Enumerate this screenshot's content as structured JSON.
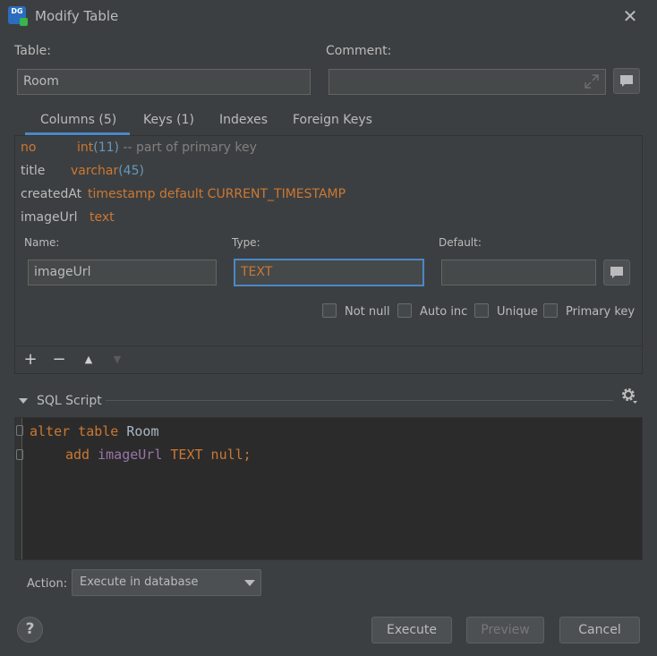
{
  "window": {
    "title": "Modify Table",
    "app_icon": "DG",
    "close_icon": "✕"
  },
  "table": {
    "label": "Table:",
    "value": "Room"
  },
  "comment": {
    "label": "Comment:",
    "value": ""
  },
  "tabs": [
    {
      "label": "Columns (5)",
      "active": true
    },
    {
      "label": "Keys (1)"
    },
    {
      "label": "Indexes"
    },
    {
      "label": "Foreign Keys"
    }
  ],
  "columns": [
    {
      "name": "no",
      "type": "int",
      "size": "(11)",
      "extra": "-- part of primary key"
    },
    {
      "name": "title",
      "type": "varchar",
      "size": "(45)",
      "extra": ""
    },
    {
      "name": "createdAt",
      "type": "timestamp default CURRENT_TIMESTAMP",
      "size": "",
      "extra": ""
    },
    {
      "name": "imageUrl",
      "type": "text",
      "size": "",
      "extra": ""
    }
  ],
  "editor": {
    "name_label": "Name:",
    "name_value": "imageUrl",
    "type_label": "Type:",
    "type_value": "TEXT",
    "default_label": "Default:",
    "default_value": ""
  },
  "checkboxes": [
    {
      "label": "Not null",
      "checked": false
    },
    {
      "label": "Auto inc",
      "checked": false
    },
    {
      "label": "Unique",
      "checked": false
    },
    {
      "label": "Primary key",
      "checked": false
    }
  ],
  "toolbar": {
    "add": "+",
    "remove": "−",
    "up": "▲",
    "down": "▼"
  },
  "sql": {
    "section_label": "SQL Script",
    "line1_kw": "alter table",
    "line1_name": "Room",
    "line2_kw": "add",
    "line2_col": "imageUrl",
    "line2_type": "TEXT null;"
  },
  "action": {
    "label": "Action:",
    "value": "Execute in database"
  },
  "buttons": {
    "help": "?",
    "execute": "Execute",
    "preview": "Preview",
    "cancel": "Cancel"
  },
  "colors": {
    "background": "#3c3f41",
    "keyword": "#cc7832",
    "number": "#6897bb",
    "accent": "#4a88c7"
  }
}
